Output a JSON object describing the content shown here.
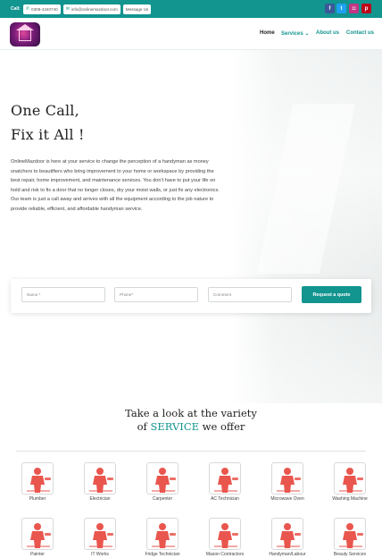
{
  "topbar": {
    "call_label": "Call:",
    "phone": "0308-4340740",
    "email": "info@onlinemazdoor.com",
    "message": "Message Us",
    "phone_icon": "phone-icon",
    "email_icon": "email-icon",
    "social": [
      {
        "name": "facebook-icon",
        "glyph": "f",
        "color": "#3b5998"
      },
      {
        "name": "twitter-icon",
        "glyph": "t",
        "color": "#1da1f2"
      },
      {
        "name": "instagram-icon",
        "glyph": "◘",
        "color": "#c13584"
      },
      {
        "name": "pinterest-icon",
        "glyph": "p",
        "color": "#bd081c"
      }
    ]
  },
  "nav": {
    "home": "Home",
    "services": "Services",
    "services_caret": "⌄",
    "about": "About us",
    "contact": "Contact us"
  },
  "hero": {
    "title_line1": "One Call,",
    "title_line2": "Fix it All !",
    "intro": "OnlineMazdoor is here at your service to change the perception of a handyman as money snatchers to beautifiers who bring improvement to your home or workspace by providing the best repair, home improvement, and maintenance services. You don't have to put your life on hold and risk to fix a door that no longer closes, dry your moist walls, or just fix any electronics. Our team is just a call away and arrives with all the equipment according to the job nature to provide reliable, efficient, and affordable handyman service."
  },
  "form": {
    "name_placeholder": "Name *",
    "phone_placeholder": "Phone*",
    "comment_placeholder": "Comment",
    "submit_label": "Request a quote"
  },
  "services_section": {
    "title_line1": "Take a look at the variety",
    "title_line2_pre": "of ",
    "title_line2_accent": "SERVICE",
    "title_line2_post": " we offer",
    "accent_color": "#12948f",
    "icon_color": "#e9564e",
    "items": [
      {
        "label": "Plumber",
        "icon": "plumber-icon"
      },
      {
        "label": "Electrician",
        "icon": "electrician-icon"
      },
      {
        "label": "Carpenter",
        "icon": "carpenter-icon"
      },
      {
        "label": "AC Technician",
        "icon": "ac-technician-icon"
      },
      {
        "label": "Microwave Oven",
        "icon": "microwave-oven-icon"
      },
      {
        "label": "Washing Machine",
        "icon": "washing-machine-icon"
      },
      {
        "label": "Painter",
        "icon": "painter-icon"
      },
      {
        "label": "IT Works",
        "icon": "it-works-icon"
      },
      {
        "label": "Fridge Technician",
        "icon": "fridge-technician-icon"
      },
      {
        "label": "Mason Contractors",
        "icon": "mason-contractors-icon"
      },
      {
        "label": "Handyman/Labour",
        "icon": "handyman-labour-icon"
      },
      {
        "label": "Beauty Services",
        "icon": "beauty-services-icon"
      }
    ]
  }
}
